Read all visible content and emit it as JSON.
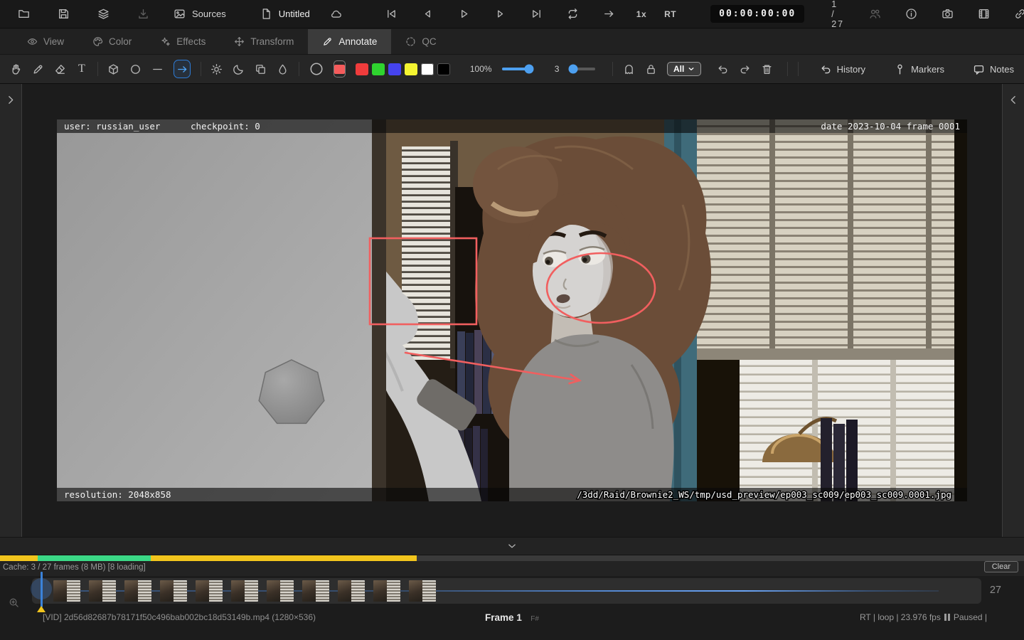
{
  "colors": {
    "accent_blue": "#3d8fe8",
    "annotation_red": "#f15f5f",
    "cache_yellow": "#f2c51d",
    "cache_green": "#3bd886"
  },
  "top_bar": {
    "sources_label": "Sources",
    "document_title": "Untitled",
    "speed_label": "1x",
    "realtime_label": "RT",
    "timecode": "00:00:00:00",
    "frame_counter": "1 / 27"
  },
  "tabs": {
    "view": "View",
    "color": "Color",
    "effects": "Effects",
    "transform": "Transform",
    "annotate": "Annotate",
    "qc": "QC"
  },
  "annotate_toolbar": {
    "text_tool_glyph": "T",
    "opacity_value": "100%",
    "brush_size_value": "3",
    "filter_value": "All",
    "history_label": "History",
    "markers_label": "Markers",
    "notes_label": "Notes",
    "selected_color": "#f45b5b",
    "palette": [
      "#f03c3c",
      "#2fd32f",
      "#4543ee",
      "#f4f431",
      "#ffffff",
      "#000000"
    ]
  },
  "viewer": {
    "overlay_top": {
      "user": "user: russian_user",
      "checkpoint": "checkpoint: 0",
      "date": "date 2023-10-04 frame 0001"
    },
    "overlay_bottom": {
      "resolution": "resolution: 2048x858",
      "path": "/3dd/Raid/Brownie2_WS/tmp/usd_preview/ep003_sc009/ep003_sc009.0001.jpg"
    }
  },
  "cache": {
    "label": "Cache: 3 / 27 frames (8 MB) [8 loading]",
    "clear_label": "Clear",
    "segments": [
      {
        "left": "0%",
        "width": "3.7%",
        "color": "#f2c51d"
      },
      {
        "left": "3.7%",
        "width": "11.0%",
        "color": "#3bd886"
      },
      {
        "left": "14.7%",
        "width": "26.0%",
        "color": "#f2c51d"
      }
    ]
  },
  "timeline": {
    "end_frame": "27",
    "thumbnail_count": 11
  },
  "status_bar": {
    "media_info": "[VID] 2d56d82687b78171f50c496bab002bc18d53149b.mp4 (1280×536)",
    "frame_label": "Frame 1",
    "frame_mode": "F#",
    "transport_info": "RT | loop | 23.976 fps",
    "paused_label": "Paused |"
  }
}
